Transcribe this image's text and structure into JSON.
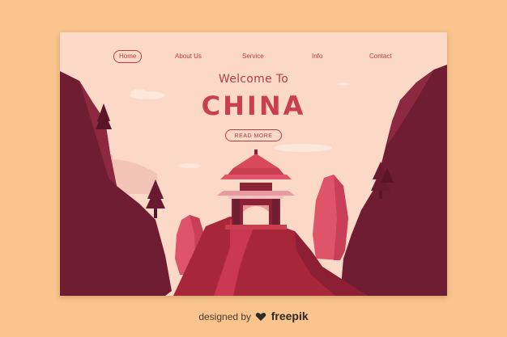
{
  "nav": {
    "items": [
      {
        "label": "Home",
        "active": true
      },
      {
        "label": "About Us",
        "active": false
      },
      {
        "label": "Service",
        "active": false
      },
      {
        "label": "Info",
        "active": false
      },
      {
        "label": "Contact",
        "active": false
      }
    ]
  },
  "hero": {
    "subtitle": "Welcome To",
    "title": "CHINA",
    "cta_label": "READ MORE"
  },
  "footer": {
    "prefix": "designed by",
    "brand": "freepik"
  },
  "colors": {
    "background": "#f9c48d",
    "card": "#fbd9c6",
    "accent": "#c93f50",
    "dark_rock": "#6f1d33",
    "path": "#a8263a"
  },
  "icons": {
    "freepik_logo": "freepik-logo-icon"
  }
}
